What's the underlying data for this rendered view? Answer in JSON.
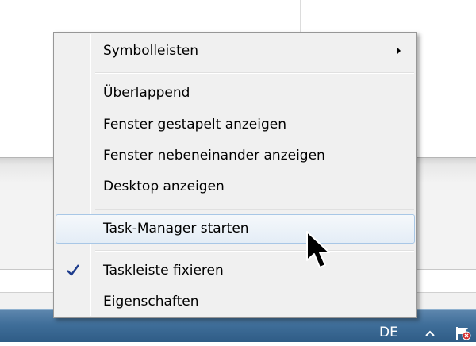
{
  "context_menu": {
    "items": [
      {
        "label": "Symbolleisten",
        "has_submenu": true
      },
      {
        "label": "Überlappend"
      },
      {
        "label": "Fenster gestapelt anzeigen"
      },
      {
        "label": "Fenster nebeneinander anzeigen"
      },
      {
        "label": "Desktop anzeigen"
      },
      {
        "label": "Task-Manager starten",
        "highlighted": true
      },
      {
        "label": "Taskleiste fixieren",
        "checked": true
      },
      {
        "label": "Eigenschaften"
      }
    ]
  },
  "taskbar": {
    "language": "DE"
  },
  "colors": {
    "taskbar": "#3f6e99",
    "menu_background": "#f0f0f0",
    "hover_border": "#a8c7e6",
    "checkmark": "#1e3c8c"
  },
  "icons": {
    "submenu": "chevron-right-icon",
    "check": "checkmark-icon",
    "cursor": "mouse-pointer-icon",
    "tray_arrow": "chevron-up-icon",
    "action_center": "flag-icon"
  }
}
